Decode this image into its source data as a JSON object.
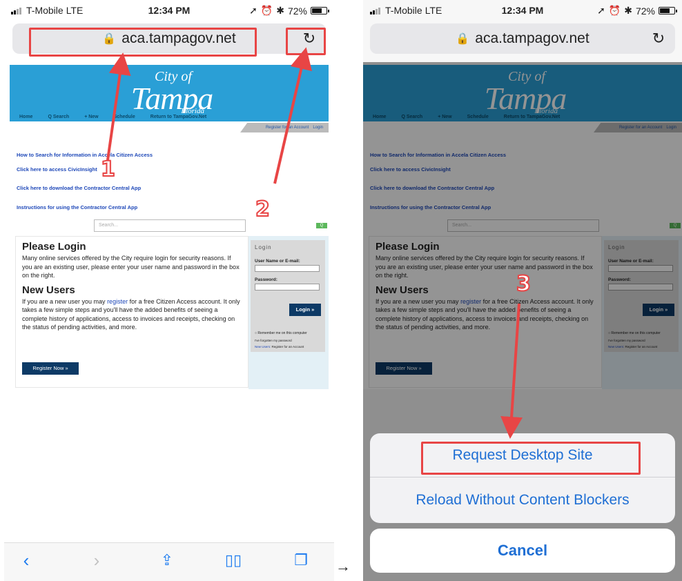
{
  "status": {
    "carrier": "T-Mobile",
    "network": "LTE",
    "time": "12:34 PM",
    "battery": "72%",
    "battery_level": 0.72
  },
  "browser": {
    "url": "aca.tampagov.net",
    "lock_icon": "lock-icon",
    "reload_icon": "reload-icon"
  },
  "site": {
    "logo": {
      "city_of": "City of",
      "name": "Tampa",
      "state": "Florida"
    },
    "nav": [
      "Home",
      "Q Search",
      "+ New",
      "Schedule",
      "Return to TampaGov.Net"
    ],
    "register_link": "Register for an Account",
    "login_link": "Login",
    "links": [
      "How to Search for Information in Accela Citizen Access",
      "Click here to access CivicInsight",
      "Click here to download the Contractor Central App",
      "Instructions for using the Contractor Central App"
    ],
    "search_placeholder": "Search...",
    "please_login": {
      "title": "Please Login",
      "body": "Many online services offered by the City require login for security reasons. If you are an existing user, please enter your user name and password in the box on the right."
    },
    "new_users": {
      "title": "New Users",
      "before_link": "If you are a new user you may ",
      "link": "register",
      "after_link": " for a free Citizen Access account. It only takes a few simple steps and you'll have the added benefits of seeing a complete history of applications, access to invoices and receipts, checking on the status of pending activities, and more."
    },
    "register_button": "Register Now »",
    "login_box": {
      "title": "Login",
      "username_label": "User Name or E-mail:",
      "password_label": "Password:",
      "login_button": "Login »",
      "remember": "Remember me on this computer",
      "forgot": "I've forgotten my password",
      "new_users_label": "New Users:",
      "new_users_link": "Register for an Account"
    }
  },
  "action_sheet": {
    "option1": "Request Desktop Site",
    "option2": "Reload Without Content Blockers",
    "cancel": "Cancel"
  },
  "annotations": {
    "step1": "1",
    "step2": "2",
    "step3": "3",
    "between_arrow": "→",
    "accent": "#e84545"
  }
}
